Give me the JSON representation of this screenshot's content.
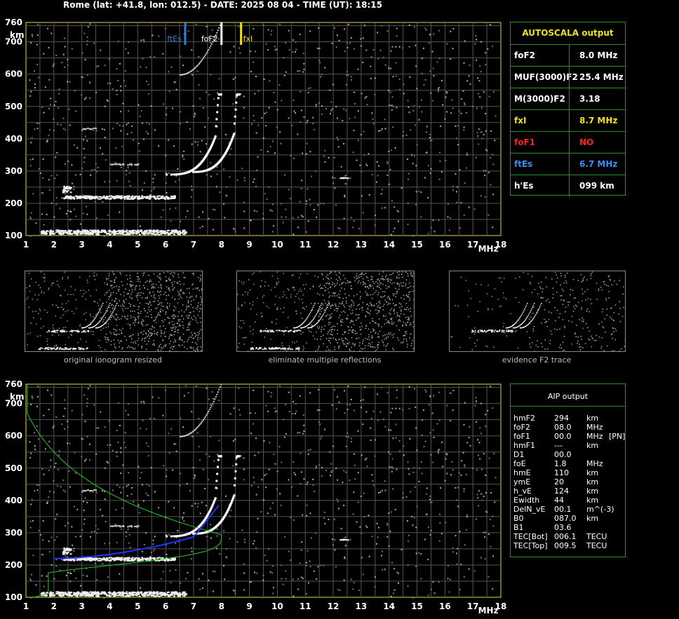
{
  "header": "Rome (lat: +41.8, lon: 012.5) - DATE: 2025 08 04 - TIME (UT): 18:15",
  "chart_data": [
    {
      "type": "scatter",
      "ylabel": "km",
      "xlabel": "MHz",
      "xlim": [
        1,
        18
      ],
      "ylim": [
        100,
        760
      ],
      "x_ticks": [
        1,
        2,
        3,
        4,
        5,
        6,
        7,
        8,
        9,
        10,
        11,
        12,
        13,
        14,
        15,
        16,
        17,
        18
      ],
      "y_ticks": [
        100,
        200,
        300,
        400,
        500,
        600,
        700,
        760
      ],
      "grid": true,
      "markers": [
        {
          "name": "ftEs",
          "x": 6.7,
          "color": "#2f7fd8"
        },
        {
          "name": "foF2",
          "x": 8.0,
          "color": "#ffffff"
        },
        {
          "name": "fxI",
          "x": 8.7,
          "color": "#f0e020"
        }
      ]
    },
    {
      "type": "scatter",
      "ylabel": "km",
      "xlabel": "MHz",
      "xlim": [
        1,
        18
      ],
      "ylim": [
        100,
        760
      ],
      "x_ticks": [
        1,
        2,
        3,
        4,
        5,
        6,
        7,
        8,
        9,
        10,
        11,
        12,
        13,
        14,
        15,
        16,
        17,
        18
      ],
      "y_ticks": [
        100,
        200,
        300,
        400,
        500,
        600,
        700,
        760
      ],
      "grid": true,
      "series": [
        {
          "color": "#22cc22",
          "kind": "profile"
        },
        {
          "color": "#2233ff",
          "kind": "trace"
        }
      ]
    }
  ],
  "autoscala": {
    "title": "AUTOSCALA output",
    "rows": [
      {
        "label": "foF2",
        "value": "8.0 MHz",
        "color": "#ffffff"
      },
      {
        "label": "MUF(3000)F2",
        "value": "25.4 MHz",
        "color": "#ffffff"
      },
      {
        "label": "M(3000)F2",
        "value": "3.18",
        "color": "#ffffff"
      },
      {
        "label": "fxI",
        "value": "8.7 MHz",
        "color": "#f0e020"
      },
      {
        "label": "foF1",
        "value": "NO",
        "color": "#ff2020"
      },
      {
        "label": "ftEs",
        "value": "6.7 MHz",
        "color": "#3a8cff"
      },
      {
        "label": "h'Es",
        "value": "099    km",
        "color": "#ffffff"
      }
    ]
  },
  "aip": {
    "title": "AIP output",
    "rows": [
      {
        "name": "hmF2",
        "value": "294",
        "unit": "km",
        "extra": ""
      },
      {
        "name": "foF2",
        "value": "08.0",
        "unit": "MHz",
        "extra": ""
      },
      {
        "name": "foF1",
        "value": "00.0",
        "unit": "MHz",
        "extra": "[PN]"
      },
      {
        "name": "hmF1",
        "value": "---",
        "unit": "km",
        "extra": ""
      },
      {
        "name": "D1",
        "value": "00.0",
        "unit": "",
        "extra": ""
      },
      {
        "name": "foE",
        "value": "1.8",
        "unit": "MHz",
        "extra": ""
      },
      {
        "name": "hmE",
        "value": "110",
        "unit": "km",
        "extra": ""
      },
      {
        "name": "ymE",
        "value": "20",
        "unit": "km",
        "extra": ""
      },
      {
        "name": "h_vE",
        "value": "124",
        "unit": "km",
        "extra": ""
      },
      {
        "name": "Ewidth",
        "value": "44",
        "unit": "km",
        "extra": ""
      },
      {
        "name": "DelN_vE",
        "value": "00.1",
        "unit": "m^(-3)",
        "extra": ""
      },
      {
        "name": "B0",
        "value": "087.0",
        "unit": "km",
        "extra": ""
      },
      {
        "name": "B1",
        "value": "03.6",
        "unit": "",
        "extra": ""
      },
      {
        "name": "TEC[Bot]",
        "value": "006.1",
        "unit": "TECU",
        "extra": ""
      },
      {
        "name": "TEC[Top]",
        "value": "009.5",
        "unit": "TECU",
        "extra": ""
      }
    ]
  },
  "thumbnails": [
    {
      "caption": "original ionogram resized"
    },
    {
      "caption": "eliminate multiple reflections"
    },
    {
      "caption": "evidence F2 trace"
    }
  ]
}
